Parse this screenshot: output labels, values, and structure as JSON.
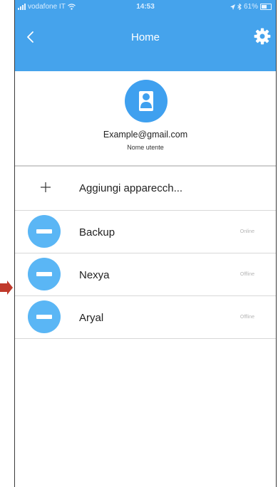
{
  "status_bar": {
    "carrier": "vodafone IT",
    "time": "14:53",
    "battery": "61%"
  },
  "nav": {
    "title": "Home",
    "back_icon": "chevron-left-icon",
    "settings_icon": "gear-icon"
  },
  "profile": {
    "avatar_icon": "user-icon",
    "email": "Example@gmail.com",
    "username": "Nome utente"
  },
  "add_device": {
    "icon": "plus-icon",
    "label": "Aggiungi apparecch..."
  },
  "devices": [
    {
      "name": "Backup",
      "status": "Online",
      "icon": "device-icon"
    },
    {
      "name": "Nexya",
      "status": "Offline",
      "icon": "device-icon"
    },
    {
      "name": "Aryal",
      "status": "Offline",
      "icon": "device-icon"
    }
  ],
  "colors": {
    "accent": "#45a3ec",
    "avatar": "#3fa0ef",
    "device_icon": "#5ab6f5",
    "pointer_arrow": "#c0392b"
  }
}
